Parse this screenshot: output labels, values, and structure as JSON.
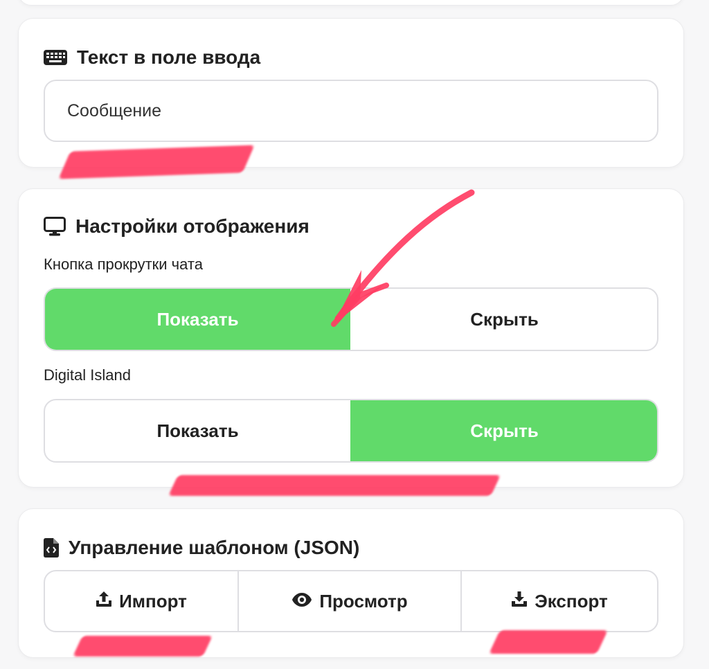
{
  "input_section": {
    "title": "Текст в поле ввода",
    "icon": "keyboard-icon",
    "value": "Сообщение"
  },
  "display_section": {
    "title": "Настройки отображения",
    "icon": "monitor-icon",
    "scroll_button": {
      "label": "Кнопка прокрутки чата",
      "options": [
        "Показать",
        "Скрыть"
      ],
      "selected": "Показать"
    },
    "digital_island": {
      "label": "Digital Island",
      "options": [
        "Показать",
        "Скрыть"
      ],
      "selected": "Скрыть"
    }
  },
  "template_section": {
    "title": "Управление шаблоном (JSON)",
    "icon": "file-code-icon",
    "import_label": "Импорт",
    "import_icon": "upload-icon",
    "preview_label": "Просмотр",
    "preview_icon": "eye-icon",
    "export_label": "Экспорт",
    "export_icon": "download-icon"
  },
  "colors": {
    "accent_green": "#61da6a",
    "annotation_red": "#ff3d63"
  }
}
